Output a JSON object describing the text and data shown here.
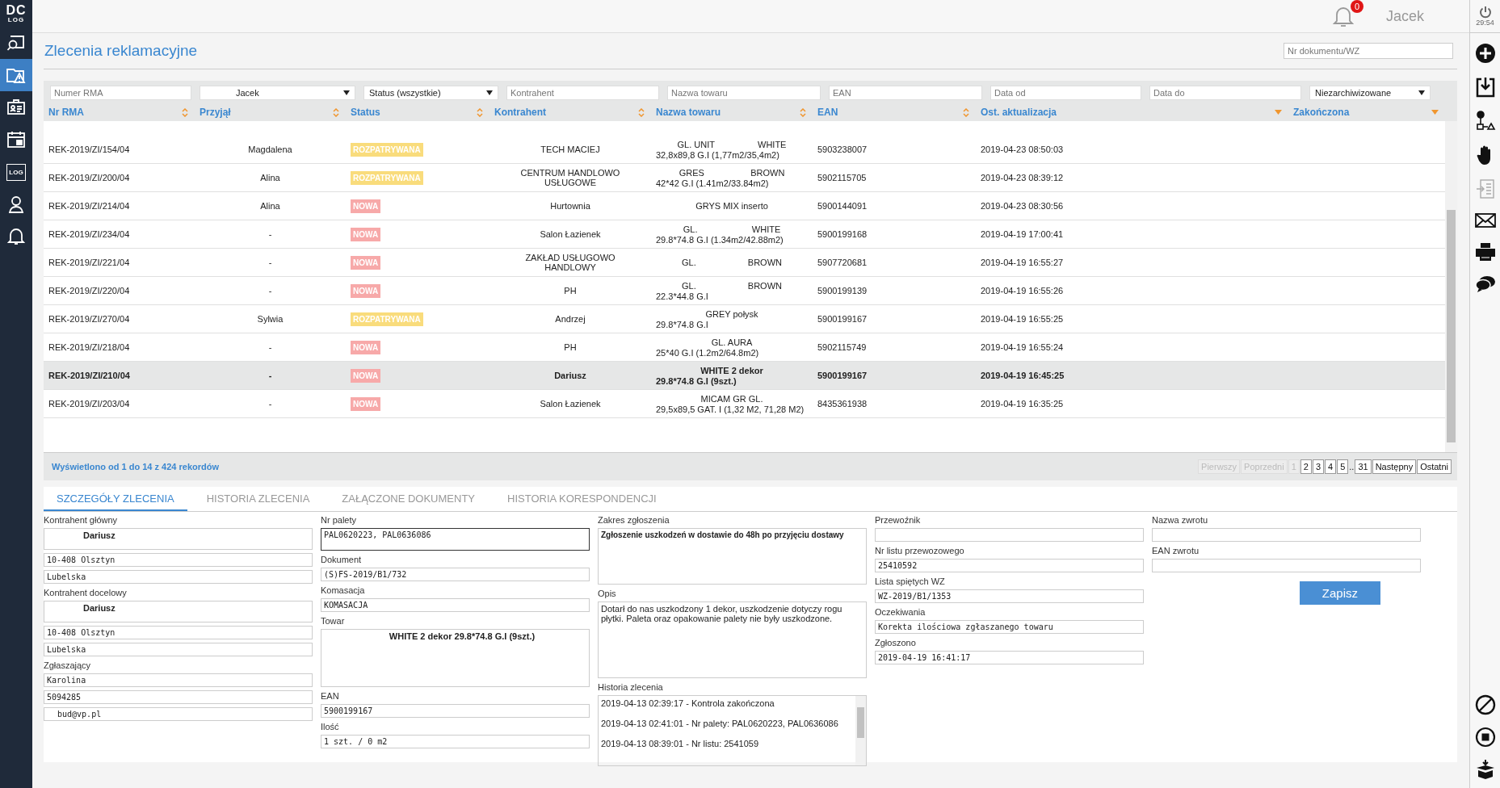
{
  "sidebar": {
    "logo": {
      "top": "DC",
      "bottom": "LOG"
    },
    "items": [
      {
        "kind": "search",
        "selected": false
      },
      {
        "kind": "warning",
        "selected": true
      },
      {
        "kind": "card",
        "selected": false
      },
      {
        "kind": "calendar",
        "selected": false
      },
      {
        "kind": "log",
        "label": "LOG",
        "selected": false
      },
      {
        "kind": "person",
        "selected": false
      },
      {
        "kind": "bell",
        "selected": false
      }
    ]
  },
  "header": {
    "notification_count": "0",
    "user": "Jacek"
  },
  "toolbar": {
    "session_time": "29:54",
    "items": [
      {
        "kind": "add",
        "disabled": false
      },
      {
        "kind": "download",
        "disabled": false
      },
      {
        "kind": "flow",
        "disabled": false
      },
      {
        "kind": "hand",
        "disabled": false
      },
      {
        "kind": "list",
        "disabled": true
      },
      {
        "kind": "mail",
        "disabled": false
      },
      {
        "kind": "print",
        "disabled": false
      },
      {
        "kind": "chat",
        "disabled": false
      }
    ],
    "bottom_items": [
      {
        "kind": "ban",
        "disabled": false
      },
      {
        "kind": "stop",
        "disabled": false
      },
      {
        "kind": "box",
        "disabled": false
      }
    ]
  },
  "page": {
    "title": "Zlecenia reklamacyjne",
    "document_search": {
      "placeholder": "Nr dokumentu/WZ"
    }
  },
  "filters": [
    {
      "kind": "input",
      "placeholder": "Numer RMA"
    },
    {
      "kind": "select",
      "value": "Jacek"
    },
    {
      "kind": "select",
      "value": "Status (wszystkie)"
    },
    {
      "kind": "input",
      "placeholder": "Kontrahent"
    },
    {
      "kind": "input",
      "placeholder": "Nazwa towaru"
    },
    {
      "kind": "input",
      "placeholder": "EAN"
    },
    {
      "kind": "input",
      "placeholder": "Data od"
    },
    {
      "kind": "input",
      "placeholder": "Data do"
    },
    {
      "kind": "select",
      "value": "Niezarchiwizowane"
    }
  ],
  "table": {
    "columns": [
      {
        "label": "Nr RMA",
        "sorted_descending": false
      },
      {
        "label": "Przyjął",
        "sorted_descending": false
      },
      {
        "label": "Status",
        "sorted_descending": false
      },
      {
        "label": "Kontrahent",
        "sorted_descending": false
      },
      {
        "label": "Nazwa towaru",
        "sorted_descending": false
      },
      {
        "label": "EAN",
        "sorted_descending": false
      },
      {
        "label": "Ost. aktualizacja",
        "sorted_descending": true
      },
      {
        "label": "Zakończona",
        "sorted_descending": true
      }
    ],
    "rows": [
      {
        "rma": "REK-2019/ZI/154/04",
        "accepted_by": "Magdalena",
        "status": {
          "label": "ROZPATRYWANA",
          "color": "#f9dc7c"
        },
        "contractor": "TECH MACIEJ",
        "product_parts": [
          "GL. UNIT",
          "WHITE"
        ],
        "product_size": "32,8x89,8 G.I (1,77m2/35,4m2)",
        "ean": "5903238007",
        "updated": "2019-04-23 08:50:03",
        "selected": false
      },
      {
        "rma": "REK-2019/ZI/200/04",
        "accepted_by": "Alina",
        "status": {
          "label": "ROZPATRYWANA",
          "color": "#f9dc7c"
        },
        "contractor": "CENTRUM HANDLOWO USŁUGOWE",
        "product_parts": [
          "GRES",
          "BROWN"
        ],
        "product_size": "42*42 G.I (1.41m2/33.84m2)",
        "ean": "5902115705",
        "updated": "2019-04-23 08:39:12",
        "selected": false
      },
      {
        "rma": "REK-2019/ZI/214/04",
        "accepted_by": "Alina",
        "status": {
          "label": "NOWA",
          "color": "#f7a9a9"
        },
        "contractor": "Hurtownia",
        "product_parts": [
          "GRYS MIX inserto"
        ],
        "ean": "5900144091",
        "updated": "2019-04-23 08:30:56",
        "selected": false
      },
      {
        "rma": "REK-2019/ZI/234/04",
        "accepted_by": "-",
        "status": {
          "label": "NOWA",
          "color": "#f7a9a9"
        },
        "contractor": "Salon Łazienek",
        "product_parts": [
          "GL.",
          "WHITE"
        ],
        "product_size": "29.8*74.8 G.I (1.34m2/42.88m2)",
        "ean": "5900199168",
        "updated": "2019-04-19 17:00:41",
        "selected": false
      },
      {
        "rma": "REK-2019/ZI/221/04",
        "accepted_by": "-",
        "status": {
          "label": "NOWA",
          "color": "#f7a9a9"
        },
        "contractor": "ZAKŁAD USŁUGOWO HANDLOWY",
        "product_parts": [
          "GL.",
          "BROWN"
        ],
        "ean": "5907720681",
        "updated": "2019-04-19 16:55:27",
        "selected": false
      },
      {
        "rma": "REK-2019/ZI/220/04",
        "accepted_by": "-",
        "status": {
          "label": "NOWA",
          "color": "#f7a9a9"
        },
        "contractor": "PH",
        "product_parts": [
          "GL.",
          "BROWN"
        ],
        "product_size": "22.3*44.8 G.I",
        "ean": "5900199139",
        "updated": "2019-04-19 16:55:26",
        "selected": false
      },
      {
        "rma": "REK-2019/ZI/270/04",
        "accepted_by": "Sylwia",
        "status": {
          "label": "ROZPATRYWANA",
          "color": "#f9dc7c"
        },
        "contractor": "Andrzej",
        "product_parts": [
          "GREY połysk"
        ],
        "product_size": "29.8*74.8 G.I",
        "ean": "5900199167",
        "updated": "2019-04-19 16:55:25",
        "selected": false
      },
      {
        "rma": "REK-2019/ZI/218/04",
        "accepted_by": "-",
        "status": {
          "label": "NOWA",
          "color": "#f7a9a9"
        },
        "contractor": "PH",
        "product_parts": [
          "GL. AURA"
        ],
        "product_size": "25*40 G.I (1.2m2/64.8m2)",
        "ean": "5902115749",
        "updated": "2019-04-19 16:55:24",
        "selected": false
      },
      {
        "rma": "REK-2019/ZI/210/04",
        "accepted_by": "-",
        "status": {
          "label": "NOWA",
          "color": "#f7a9a9"
        },
        "contractor": "Dariusz",
        "product_parts": [
          "WHITE 2 dekor"
        ],
        "product_size": "29.8*74.8 G.I (9szt.)",
        "ean": "5900199167",
        "updated": "2019-04-19 16:45:25",
        "selected": true
      },
      {
        "rma": "REK-2019/ZI/203/04",
        "accepted_by": "-",
        "status": {
          "label": "NOWA",
          "color": "#f7a9a9"
        },
        "contractor": "Salon Łazienek",
        "product_parts": [
          "MICAM GR GL."
        ],
        "product_size": "29,5x89,5 GAT. I (1,32 M2, 71,28 M2)",
        "ean": "8435361938",
        "updated": "2019-04-19 16:35:25",
        "selected": false
      }
    ],
    "summary": "Wyświetlono od 1 do 14 z 424 rekordów",
    "pagination": [
      {
        "kind": "nav",
        "label": "Pierwszy",
        "disabled": true
      },
      {
        "kind": "nav",
        "label": "Poprzedni",
        "disabled": true
      },
      {
        "kind": "page",
        "label": "1",
        "disabled": true
      },
      {
        "kind": "page",
        "label": "2",
        "disabled": false
      },
      {
        "kind": "page",
        "label": "3",
        "disabled": false
      },
      {
        "kind": "page",
        "label": "4",
        "disabled": false
      },
      {
        "kind": "page",
        "label": "5",
        "disabled": false
      },
      {
        "kind": "gap",
        "label": ".."
      },
      {
        "kind": "page",
        "label": "31",
        "disabled": false
      },
      {
        "kind": "nav",
        "label": "Następny",
        "disabled": false
      },
      {
        "kind": "nav",
        "label": "Ostatni",
        "disabled": false
      }
    ]
  },
  "tabs": [
    {
      "label": "SZCZEGÓŁY ZLECENIA",
      "selected": true
    },
    {
      "label": "HISTORIA ZLECENIA",
      "selected": false
    },
    {
      "label": "ZAŁĄCZONE DOKUMENTY",
      "selected": false
    },
    {
      "label": "HISTORIA KORESPONDENCJI",
      "selected": false
    }
  ],
  "details": [
    [
      {
        "label": "Kontrahent główny",
        "fields": [
          {
            "kind": "name",
            "value": "Dariusz"
          },
          {
            "kind": "line",
            "value": "10-408 Olsztyn"
          },
          {
            "kind": "line",
            "value": "Lubelska"
          }
        ]
      },
      {
        "label": "Kontrahent docelowy",
        "fields": [
          {
            "kind": "name",
            "value": "Dariusz"
          },
          {
            "kind": "line",
            "value": "10-408 Olsztyn"
          },
          {
            "kind": "line",
            "value": "Lubelska"
          }
        ]
      },
      {
        "label": "Zgłaszający",
        "fields": [
          {
            "kind": "line",
            "value": "Karolina"
          },
          {
            "kind": "line",
            "value": "5094285"
          },
          {
            "kind": "indented",
            "value": "bud@vp.pl"
          }
        ]
      }
    ],
    [
      {
        "label": "Nr palety",
        "fields": [
          {
            "kind": "focused",
            "value": "PAL0620223, PAL0636086"
          }
        ]
      },
      {
        "label": "Dokument",
        "fields": [
          {
            "kind": "line",
            "value": "(S)FS-2019/B1/732"
          }
        ]
      },
      {
        "label": "Komasacja",
        "fields": [
          {
            "kind": "line",
            "value": "KOMASACJA"
          }
        ]
      },
      {
        "label": "Towar",
        "fields": [
          {
            "kind": "product",
            "value": "WHITE 2 dekor  29.8*74.8  G.I  (9szt.)"
          }
        ]
      },
      {
        "label": "EAN",
        "fields": [
          {
            "kind": "line",
            "value": "5900199167"
          }
        ]
      },
      {
        "label": "Ilość",
        "fields": [
          {
            "kind": "line",
            "value": "1 szt.  / 0 m2"
          }
        ]
      }
    ],
    [
      {
        "label": "Zakres zgłoszenia",
        "fields": [
          {
            "kind": "scope",
            "value": "Zgłoszenie uszkodzeń w dostawie do 48h po przyjęciu dostawy"
          }
        ]
      },
      {
        "label": "Opis",
        "fields": [
          {
            "kind": "note",
            "value": "Dotarł do nas uszkodzony 1 dekor, uszkodzenie dotyczy rogu płytki. Paleta oraz opakowanie palety nie były uszkodzone."
          }
        ]
      },
      {
        "label": "Historia zlecenia",
        "fields": [
          {
            "kind": "history",
            "entries": [
              "2019-04-13 02:39:17 - Kontrola zakończona",
              "2019-04-13 02:41:01 - Nr palety: PAL0620223, PAL0636086",
              "2019-04-13 08:39:01 - Nr listu: 2541059"
            ]
          }
        ]
      }
    ],
    [
      {
        "label": "Przewoźnik",
        "fields": [
          {
            "kind": "line"
          }
        ]
      },
      {
        "label": "Nr listu przewozowego",
        "fields": [
          {
            "kind": "line",
            "value": "25410592"
          }
        ]
      },
      {
        "label": "Lista spiętych WZ",
        "fields": [
          {
            "kind": "line",
            "value": "WZ-2019/B1/1353"
          }
        ]
      },
      {
        "label": "Oczekiwania",
        "fields": [
          {
            "kind": "line",
            "value": "Korekta ilościowa zgłaszanego towaru"
          }
        ]
      },
      {
        "label": "Zgłoszono",
        "fields": [
          {
            "kind": "line",
            "value": "2019-04-19 16:41:17"
          }
        ]
      }
    ],
    [
      {
        "label": "Nazwa zwrotu",
        "fields": [
          {
            "kind": "line"
          }
        ]
      },
      {
        "label": "EAN zwrotu",
        "fields": [
          {
            "kind": "line"
          }
        ]
      },
      {
        "fields": [
          {
            "kind": "button",
            "value": "Zapisz"
          }
        ]
      }
    ]
  ]
}
